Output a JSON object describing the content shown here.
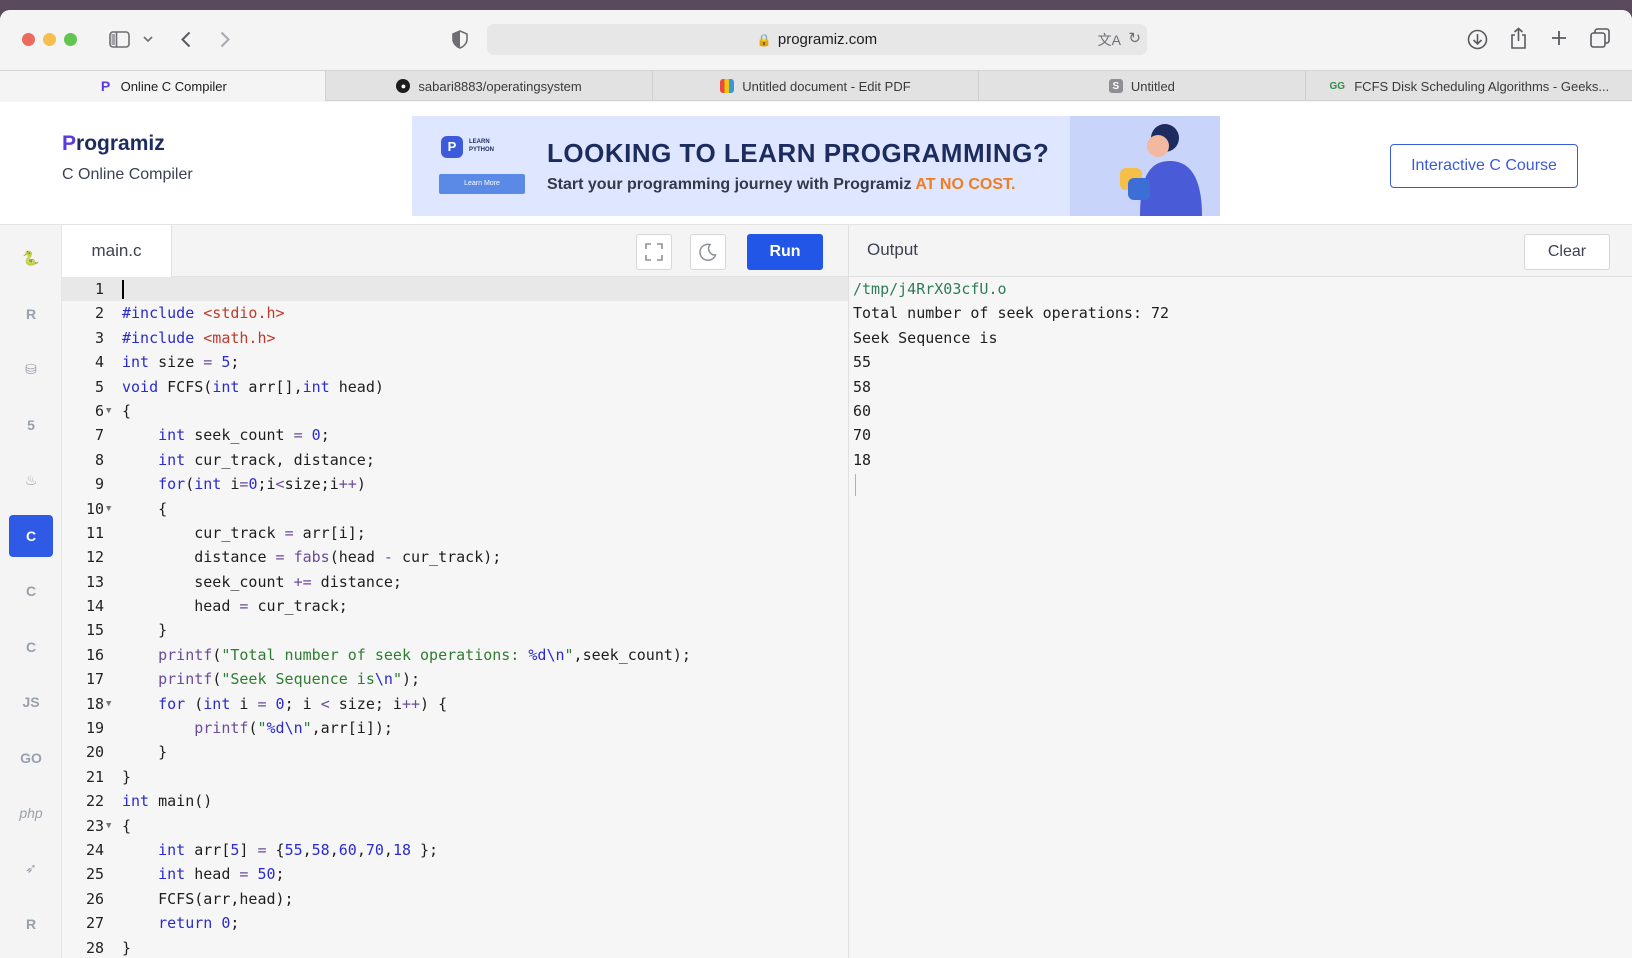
{
  "browser": {
    "address": "programiz.com",
    "tabs": [
      {
        "label": "Online C Compiler",
        "active": true,
        "icon": "programiz-icon"
      },
      {
        "label": "sabari8883/operatingsystem",
        "active": false,
        "icon": "github-icon"
      },
      {
        "label": "Untitled document - Edit PDF",
        "active": false,
        "icon": "pdf-editor-icon"
      },
      {
        "label": "Untitled",
        "active": false,
        "icon": "s-letter-icon"
      },
      {
        "label": "FCFS Disk Scheduling Algorithms - Geeks...",
        "active": false,
        "icon": "geeksforgeeks-icon"
      }
    ]
  },
  "header": {
    "brand": "rogramiz",
    "brand_initial": "P",
    "subtitle": "C Online Compiler",
    "course_button": "Interactive C Course"
  },
  "banner": {
    "mini_badge": "LEARN PYTHON",
    "mini_button": "Learn More",
    "headline": "LOOKING TO LEARN PROGRAMMING?",
    "subline": "Start your programming journey with Programiz ",
    "highlight": "AT NO COST."
  },
  "editor": {
    "file_name": "main.c",
    "run_label": "Run",
    "lines": [
      "",
      "#include <stdio.h>",
      "#include <math.h>",
      "int size = 5;",
      "void FCFS(int arr[],int head)",
      "{",
      "    int seek_count = 0;",
      "    int cur_track, distance;",
      "    for(int i=0;i<size;i++)",
      "    {",
      "        cur_track = arr[i];",
      "        distance = fabs(head - cur_track);",
      "        seek_count += distance;",
      "        head = cur_track;",
      "    }",
      "    printf(\"Total number of seek operations: %d\\n\",seek_count);",
      "    printf(\"Seek Sequence is\\n\");",
      "    for (int i = 0; i < size; i++) {",
      "        printf(\"%d\\n\",arr[i]);",
      "    }",
      "}",
      "int main()",
      "{",
      "    int arr[5] = {55,58,60,70,18 };",
      "    int head = 50;",
      "    FCFS(arr,head);",
      "    return 0;",
      "}"
    ],
    "fold_lines": [
      6,
      10,
      18,
      23
    ]
  },
  "output": {
    "title": "Output",
    "clear_label": "Clear",
    "lines": [
      "/tmp/j4RrX03cfU.o",
      "Total number of seek operations: 72",
      "Seek Sequence is",
      "55",
      "58",
      "60",
      "70",
      "18"
    ]
  },
  "languages": [
    {
      "name": "python-icon",
      "glyph": "🐍",
      "active": false
    },
    {
      "name": "r-lang-icon",
      "glyph": "R",
      "active": false
    },
    {
      "name": "sql-icon",
      "glyph": "⛁",
      "active": false
    },
    {
      "name": "html-icon",
      "glyph": "5",
      "active": false
    },
    {
      "name": "java-icon",
      "glyph": "♨",
      "active": false
    },
    {
      "name": "c-icon",
      "glyph": "C",
      "active": true
    },
    {
      "name": "cpp-icon",
      "glyph": "C",
      "active": false
    },
    {
      "name": "csharp-icon",
      "glyph": "C",
      "active": false
    },
    {
      "name": "javascript-icon",
      "glyph": "JS",
      "active": false
    },
    {
      "name": "go-icon",
      "glyph": "GO",
      "active": false
    },
    {
      "name": "php-icon",
      "glyph": "php",
      "active": false
    },
    {
      "name": "swift-icon",
      "glyph": "➶",
      "active": false
    },
    {
      "name": "rust-icon",
      "glyph": "R",
      "active": false
    }
  ],
  "colors": {
    "accent": "#2156e6",
    "brand": "#5b3be0",
    "highlight": "#f07d20"
  }
}
